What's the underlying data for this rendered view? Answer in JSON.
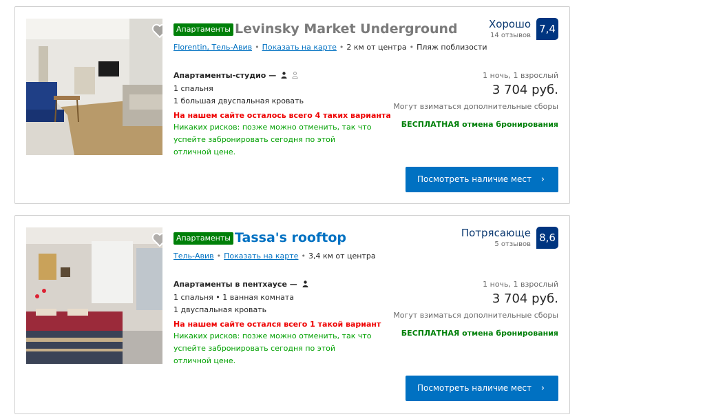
{
  "listings": [
    {
      "badge": "Апартаменты",
      "name": "Levinsky Market Underground",
      "location": "Florentin, Тель-Авив",
      "show_on_map": "Показать на карте",
      "distance": "2 км от центра",
      "extra": "Пляж поблизости",
      "score_label": "Хорошо",
      "reviews": "14 отзывов",
      "score": "7,4",
      "room_type": "Апартаменты-студио —",
      "details": [
        "1 спальня",
        "1 большая двуспальная кровать"
      ],
      "scarcity": "На нашем сайте осталось всего 4 таких варианта",
      "no_risk": "Никаких рисков: позже можно отменить, так что успейте забронировать сегодня по этой отличной цене.",
      "nights": "1 ночь, 1 взрослый",
      "price": "3 704 руб.",
      "fees": "Могут взиматься дополнительные сборы",
      "free_cancel": "БЕСПЛАТНАЯ отмена бронирования",
      "button": "Посмотреть наличие мест",
      "chevron": "›",
      "icons": [
        "heart-icon",
        "person-icon",
        "person-outline-icon"
      ]
    },
    {
      "badge": "Апартаменты",
      "name": "Tassa's rooftop",
      "location": "Тель-Авив",
      "show_on_map": "Показать на карте",
      "distance": "3,4 км от центра",
      "score_label": "Потрясающе",
      "reviews": "5 отзывов",
      "score": "8,6",
      "room_type": "Апартаменты в пентхаусе —",
      "details": [
        "1 спальня • 1 ванная комната",
        "1 двуспальная кровать"
      ],
      "scarcity": "На нашем сайте остался всего 1 такой вариант",
      "no_risk": "Никаких рисков: позже можно отменить, так что успейте забронировать сегодня по этой отличной цене.",
      "nights": "1 ночь, 1 взрослый",
      "price": "3 704 руб.",
      "fees": "Могут взиматься дополнительные сборы",
      "free_cancel": "БЕСПЛАТНАЯ отмена бронирования",
      "button": "Посмотреть наличие мест",
      "chevron": "›",
      "icons": [
        "heart-icon",
        "person-icon"
      ]
    }
  ],
  "colors": {
    "brand_blue": "#0071c2",
    "score_bg": "#003580",
    "badge_green": "#008009",
    "scarcity_red": "#e00000",
    "no_risk_green": "#00a000"
  }
}
